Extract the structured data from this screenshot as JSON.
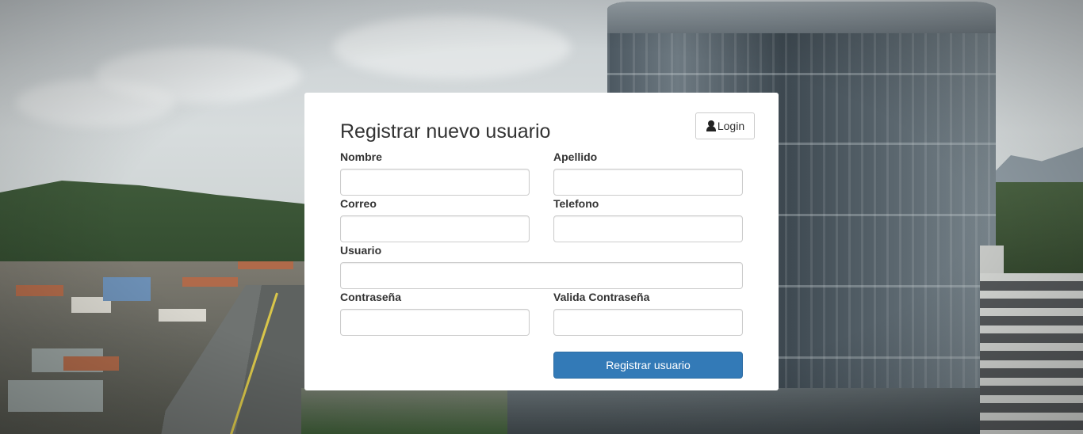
{
  "form": {
    "title": "Registrar nuevo usuario",
    "login_button": "Login",
    "login_icon": "user-icon",
    "fields": {
      "nombre": {
        "label": "Nombre",
        "value": "",
        "placeholder": ""
      },
      "apellido": {
        "label": "Apellido",
        "value": "",
        "placeholder": ""
      },
      "correo": {
        "label": "Correo",
        "value": "",
        "placeholder": ""
      },
      "telefono": {
        "label": "Telefono",
        "value": "",
        "placeholder": ""
      },
      "usuario": {
        "label": "Usuario",
        "value": "",
        "placeholder": ""
      },
      "contrasena": {
        "label": "Contraseña",
        "value": "",
        "placeholder": ""
      },
      "valida_contrasena": {
        "label": "Valida Contraseña",
        "value": "",
        "placeholder": ""
      }
    },
    "submit_button": "Registrar usuario"
  },
  "colors": {
    "primary": "#337ab7",
    "card_background": "#ffffff",
    "text": "#333333",
    "input_border": "#cccccc"
  }
}
